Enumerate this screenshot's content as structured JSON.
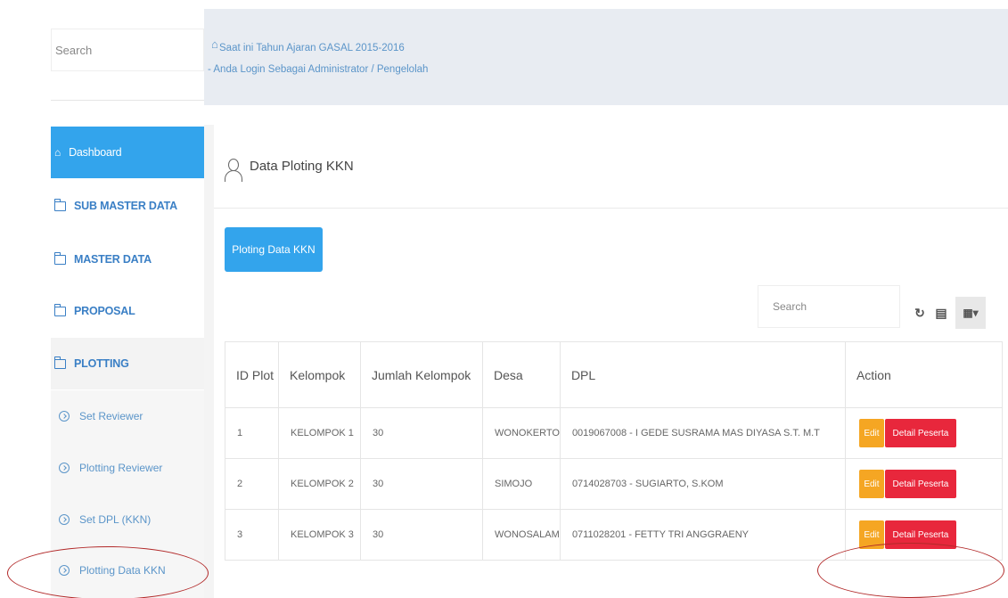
{
  "sidebar": {
    "search_placeholder": "Search",
    "items": [
      {
        "label": "Dashboard"
      },
      {
        "label": "SUB MASTER DATA"
      },
      {
        "label": "MASTER DATA"
      },
      {
        "label": "PROPOSAL"
      },
      {
        "label": "PLOTTING"
      }
    ],
    "sub_items": [
      {
        "label": "Set Reviewer"
      },
      {
        "label": "Plotting Reviewer"
      },
      {
        "label": "Set DPL (KKN)"
      },
      {
        "label": "Plotting Data KKN"
      }
    ]
  },
  "info": {
    "academic_year": "Saat ini Tahun Ajaran GASAL 2015-2016",
    "login_role": "- Anda Login Sebagai Administrator / Pengelolah"
  },
  "panel": {
    "title": "Data Ploting KKN",
    "add_button": "Ploting Data KKN",
    "search_placeholder": "Search",
    "refresh_icon": "refresh-icon",
    "toggle_icon": "list-toggle-icon",
    "columns_icon": "columns-icon"
  },
  "table": {
    "headers": [
      "ID Plot",
      "Kelompok",
      "Jumlah Kelompok",
      "Desa",
      "DPL",
      "Action"
    ],
    "rows": [
      [
        "1",
        "KELOMPOK 1",
        "30",
        "WONOKERTO",
        "0019067008 - I GEDE SUSRAMA MAS DIYASA S.T. M.T"
      ],
      [
        "2",
        "KELOMPOK 2",
        "30",
        "SIMOJO",
        "0714028703 - SUGIARTO, S.KOM"
      ],
      [
        "3",
        "KELOMPOK 3",
        "30",
        "WONOSALAM",
        "0711028201 - FETTY TRI ANGGRAENY"
      ]
    ],
    "edit_label": "Edit",
    "detail_label": "Detail Peserta"
  },
  "colors": {
    "primary": "#33a4ec",
    "edit": "#f5a623",
    "danger": "#e8273c",
    "annotation": "#b22a2a"
  }
}
